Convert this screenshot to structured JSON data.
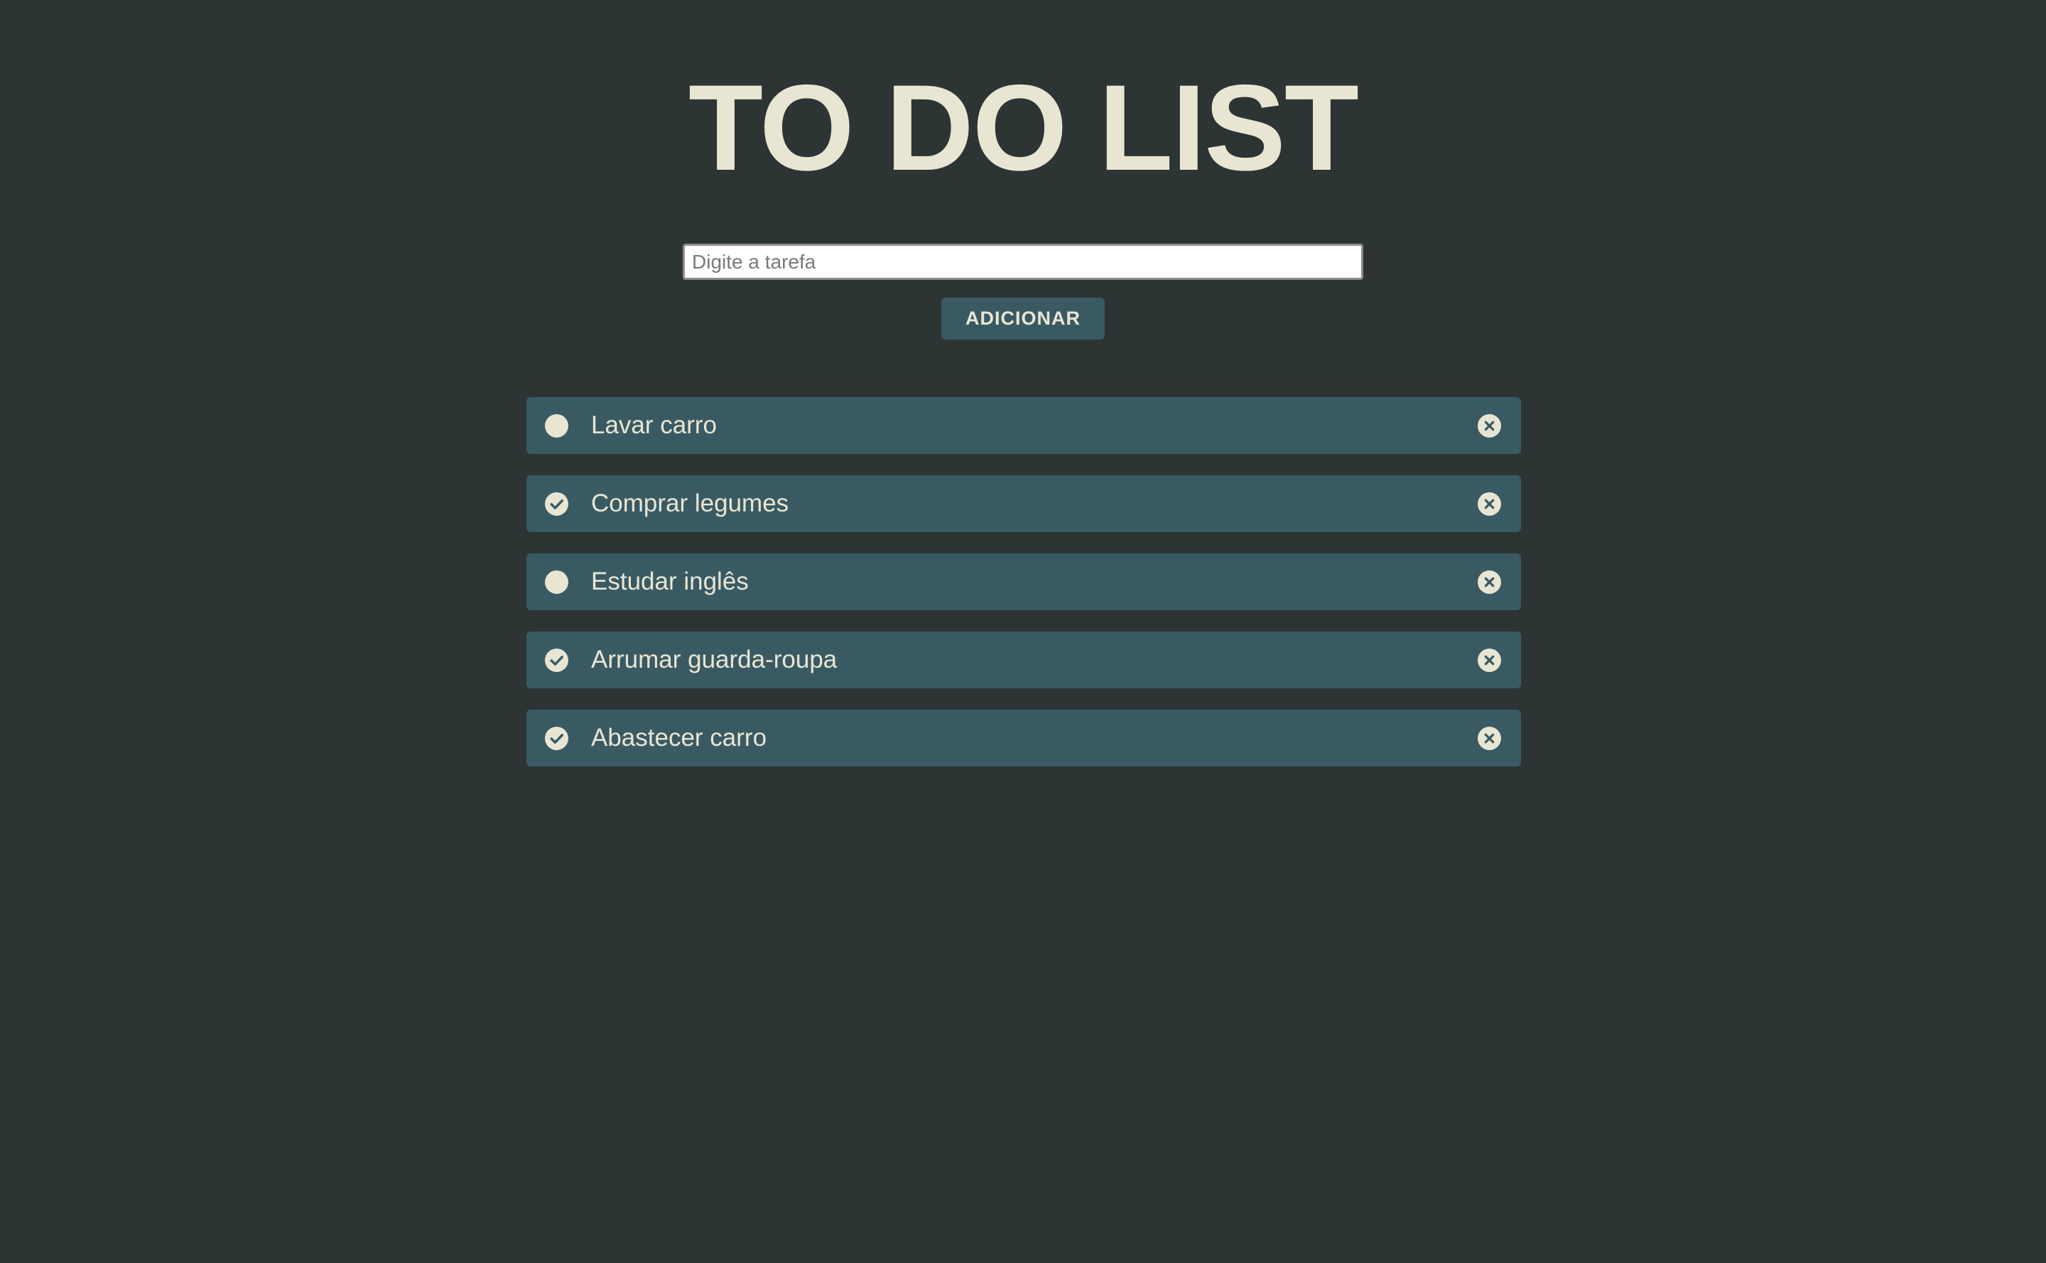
{
  "app": {
    "title": "TO DO LIST"
  },
  "input": {
    "placeholder": "Digite a tarefa",
    "value": ""
  },
  "add_button": {
    "label": "ADICIONAR"
  },
  "tasks": [
    {
      "text": "Lavar carro",
      "done": false
    },
    {
      "text": "Comprar legumes",
      "done": true
    },
    {
      "text": "Estudar inglês",
      "done": false
    },
    {
      "text": "Arrumar guarda-roupa",
      "done": true
    },
    {
      "text": "Abastecer carro",
      "done": true
    }
  ],
  "icons": {
    "pending": "circle-icon",
    "done": "check-circle-icon",
    "remove": "close-circle-icon"
  },
  "colors": {
    "background": "#2c3434",
    "accent": "#3a5a63",
    "text": "#e8e6d3"
  }
}
